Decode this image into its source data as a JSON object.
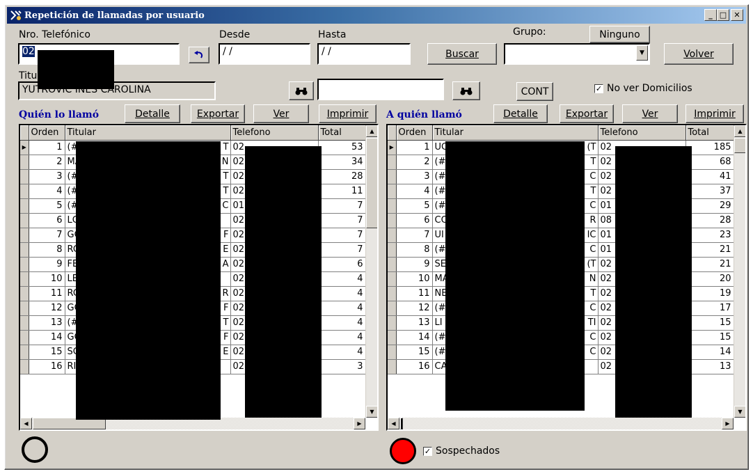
{
  "window": {
    "title": "Repetición de llamadas por usuario",
    "buttons": [
      "_",
      "□",
      "✕"
    ]
  },
  "search": {
    "phone_label": "Nro. Telefónico",
    "phone_value": "02",
    "undo_icon": "undo-arrow-icon",
    "desde_label": "Desde",
    "desde_value": "/ /",
    "hasta_label": "Hasta",
    "hasta_value": "/ /",
    "buscar_label": "Buscar",
    "grupo_label": "Grupo:",
    "ninguno_label": "Ninguno",
    "grupo_value": "",
    "volver_label": "Volver",
    "titular_label": "Titu",
    "titular_value": "YUTROVIC INES CAROLINA",
    "find_value": "",
    "cont_label": "CONT",
    "no_domicilios_label": "No ver Domicilios",
    "no_domicilios_checked": true
  },
  "left": {
    "heading": "Quién lo llamó",
    "detalle": "Detalle",
    "exportar": "Exportar",
    "ver": "Ver",
    "imprimir": "Imprimir",
    "columns": [
      "Orden",
      "Titular",
      "Telefono",
      "Total"
    ],
    "rows": [
      {
        "orden": "1",
        "titular": "(#",
        "tit_end": "T",
        "tel": "02",
        "total": "53"
      },
      {
        "orden": "2",
        "titular": "MA",
        "tit_end": "N",
        "tel": "02",
        "total": "34"
      },
      {
        "orden": "3",
        "titular": "(#",
        "tit_end": "T",
        "tel": "02",
        "total": "28"
      },
      {
        "orden": "4",
        "titular": "(#",
        "tit_end": "T",
        "tel": "02",
        "total": "11"
      },
      {
        "orden": "5",
        "titular": "(#",
        "tit_end": "C",
        "tel": "01",
        "total": "7"
      },
      {
        "orden": "6",
        "titular": "LC",
        "tit_end": "",
        "tel": "02",
        "total": "7"
      },
      {
        "orden": "7",
        "titular": "GC",
        "tit_end": "F",
        "tel": "02",
        "total": "7"
      },
      {
        "orden": "8",
        "titular": "RC",
        "tit_end": "E",
        "tel": "02",
        "total": "7"
      },
      {
        "orden": "9",
        "titular": "FE",
        "tit_end": "A",
        "tel": "02",
        "total": "6"
      },
      {
        "orden": "10",
        "titular": "LE",
        "tit_end": "",
        "tel": "02",
        "total": "4"
      },
      {
        "orden": "11",
        "titular": "RC",
        "tit_end": "R",
        "tel": "02",
        "total": "4"
      },
      {
        "orden": "12",
        "titular": "GC",
        "tit_end": "F",
        "tel": "02",
        "total": "4"
      },
      {
        "orden": "13",
        "titular": "(#",
        "tit_end": "T",
        "tel": "02",
        "total": "4"
      },
      {
        "orden": "14",
        "titular": "GC",
        "tit_end": "F",
        "tel": "02",
        "total": "4"
      },
      {
        "orden": "15",
        "titular": "SC",
        "tit_end": "E",
        "tel": "02",
        "total": "4"
      },
      {
        "orden": "16",
        "titular": "RI",
        "tit_end": "",
        "tel": "02",
        "total": "3"
      }
    ]
  },
  "right": {
    "heading": "A quién llamó",
    "detalle": "Detalle",
    "exportar": "Exportar",
    "ver": "Ver",
    "imprimir": "Imprimir",
    "columns": [
      "Orden",
      "Titular",
      "Telefono",
      "Total"
    ],
    "rows": [
      {
        "orden": "1",
        "titular": "UC",
        "tit_end": "(T",
        "tel": "02",
        "total": "185"
      },
      {
        "orden": "2",
        "titular": "(#",
        "tit_end": "T",
        "tel": "02",
        "total": "68"
      },
      {
        "orden": "3",
        "titular": "(#",
        "tit_end": "C",
        "tel": "02",
        "total": "41"
      },
      {
        "orden": "4",
        "titular": "(#",
        "tit_end": "T",
        "tel": "02",
        "total": "37"
      },
      {
        "orden": "5",
        "titular": "(#",
        "tit_end": "C",
        "tel": "01",
        "total": "29"
      },
      {
        "orden": "6",
        "titular": "CC",
        "tit_end": "R",
        "tel": "08",
        "total": "28"
      },
      {
        "orden": "7",
        "titular": "UI",
        "tit_end": "IC",
        "tel": "01",
        "total": "23"
      },
      {
        "orden": "8",
        "titular": "(#",
        "tit_end": "C",
        "tel": "01",
        "total": "21"
      },
      {
        "orden": "9",
        "titular": "SE",
        "tit_end": "(T",
        "tel": "02",
        "total": "21"
      },
      {
        "orden": "10",
        "titular": "MA",
        "tit_end": "N",
        "tel": "02",
        "total": "20"
      },
      {
        "orden": "11",
        "titular": "NE",
        "tit_end": "T",
        "tel": "02",
        "total": "19"
      },
      {
        "orden": "12",
        "titular": "(#",
        "tit_end": "C",
        "tel": "02",
        "total": "17"
      },
      {
        "orden": "13",
        "titular": "LI",
        "tit_end": "TI",
        "tel": "02",
        "total": "15"
      },
      {
        "orden": "14",
        "titular": "(#",
        "tit_end": "C",
        "tel": "02",
        "total": "15"
      },
      {
        "orden": "15",
        "titular": "(#",
        "tit_end": "C",
        "tel": "02",
        "total": "14"
      },
      {
        "orden": "16",
        "titular": "CARLOS MIGUEL",
        "tit_end": "",
        "tel": "02",
        "total": "13"
      }
    ]
  },
  "footer": {
    "sospechados_label": "Sospechados",
    "sospechados_checked": true,
    "status_left_color": "#d4d0c8",
    "status_right_color": "#ff0000"
  }
}
